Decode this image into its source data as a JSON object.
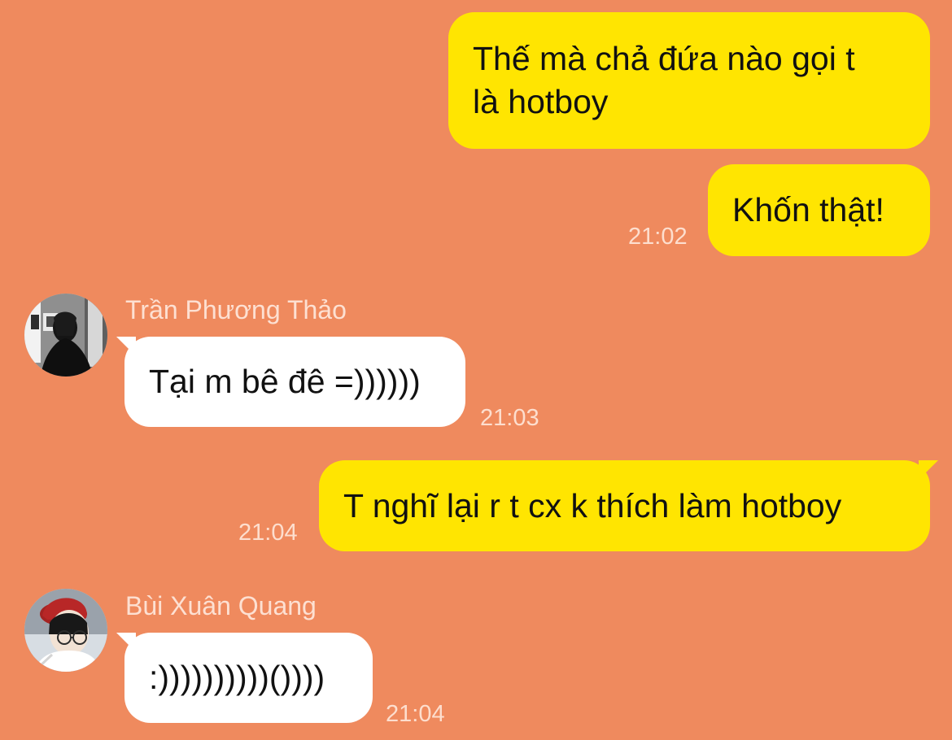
{
  "messages": [
    {
      "sender": "me",
      "lines": [
        "Thế mà chả đứa nào gọi t",
        "là hotboy"
      ],
      "time": ""
    },
    {
      "sender": "me",
      "lines": [
        "Khốn thật!"
      ],
      "time": "21:02"
    },
    {
      "sender": "Trần Phương Thảo",
      "avatar": "woman-avatar",
      "lines": [
        "Tại m bê đê =))))))"
      ],
      "time": "21:03"
    },
    {
      "sender": "me",
      "lines": [
        "T nghĩ lại r t cx k thích làm hotboy"
      ],
      "time": "21:04"
    },
    {
      "sender": "Bùi Xuân Quang",
      "avatar": "boy-beret-avatar",
      "lines": [
        ":))))))))))())))"
      ],
      "time": "21:04"
    }
  ],
  "colors": {
    "background": "#ef8a5e",
    "my_bubble": "#ffe501",
    "their_bubble": "#ffffff",
    "meta_text": "#ffece2"
  }
}
